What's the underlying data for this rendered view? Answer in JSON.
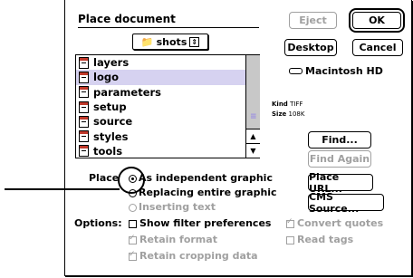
{
  "dialog": {
    "title": "Place document",
    "folder_popup": "shots",
    "files": [
      "layers",
      "logo",
      "parameters",
      "setup",
      "source",
      "styles",
      "tools"
    ],
    "selected_file": "logo"
  },
  "buttons": {
    "eject": "Eject",
    "ok": "OK",
    "desktop": "Desktop",
    "cancel": "Cancel",
    "find": "Find...",
    "find_again": "Find Again",
    "place_url": "Place URL...",
    "cms_source": "CMS Source..."
  },
  "disk": {
    "name": "Macintosh HD"
  },
  "info": {
    "kind_label": "Kind",
    "kind_value": "TIFF",
    "size_label": "Size",
    "size_value": "108K"
  },
  "place": {
    "label": "Place",
    "options": [
      "As independent graphic",
      "Replacing entire graphic",
      "Inserting text"
    ],
    "selected": "As independent graphic"
  },
  "options": {
    "label": "Options:",
    "show_filter": "Show filter preferences",
    "retain_format": "Retain format",
    "retain_cropping": "Retain cropping data",
    "convert_quotes": "Convert quotes",
    "read_tags": "Read tags"
  }
}
